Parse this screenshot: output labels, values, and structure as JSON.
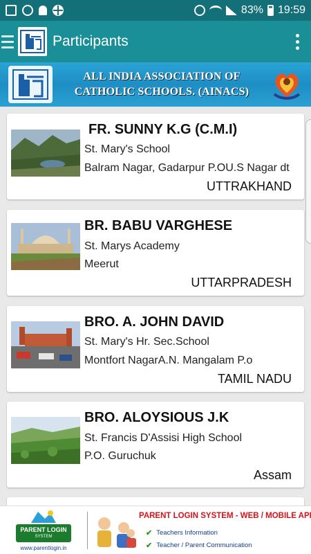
{
  "status_bar": {
    "battery": "83%",
    "time": "19:59"
  },
  "app_bar": {
    "title": "Participants"
  },
  "banner": {
    "line1": "ALL INDIA ASSOCIATION OF",
    "line2": "CATHOLIC SCHOOLS. (AINACS)"
  },
  "participants": [
    {
      "name": "FR. SUNNY K.G (C.M.I)",
      "school": "St. Mary's School",
      "address": "Balram Nagar, Gadarpur P.OU.S Nagar dt",
      "state": "UTTRAKHAND"
    },
    {
      "name": "BR. BABU VARGHESE",
      "school": "St. Marys Academy",
      "address": "Meerut",
      "state": "UTTARPRADESH"
    },
    {
      "name": "BRO. A. JOHN DAVID",
      "school": "St. Mary's Hr. Sec.School",
      "address": "Montfort NagarA.N. Mangalam P.o",
      "state": "TAMIL NADU"
    },
    {
      "name": "BRO. ALOYSIOUS J.K",
      "school": "St. Francis D'Assisi High School",
      "address": "P.O. Guruchuk",
      "state": "Assam"
    }
  ],
  "ad": {
    "badge_line1": "PARENT LOGIN",
    "badge_line2": "SYSTEM",
    "url": "www.parentlogin.in",
    "title": "PARENT LOGIN SYSTEM -  WEB / MOBILE APP",
    "item1": "Teachers Information",
    "item2": "Teacher / Parent Communication"
  },
  "colors": {
    "status_bar": "#136f78",
    "app_bar": "#1a8f97",
    "banner": "#1e8ec4"
  }
}
